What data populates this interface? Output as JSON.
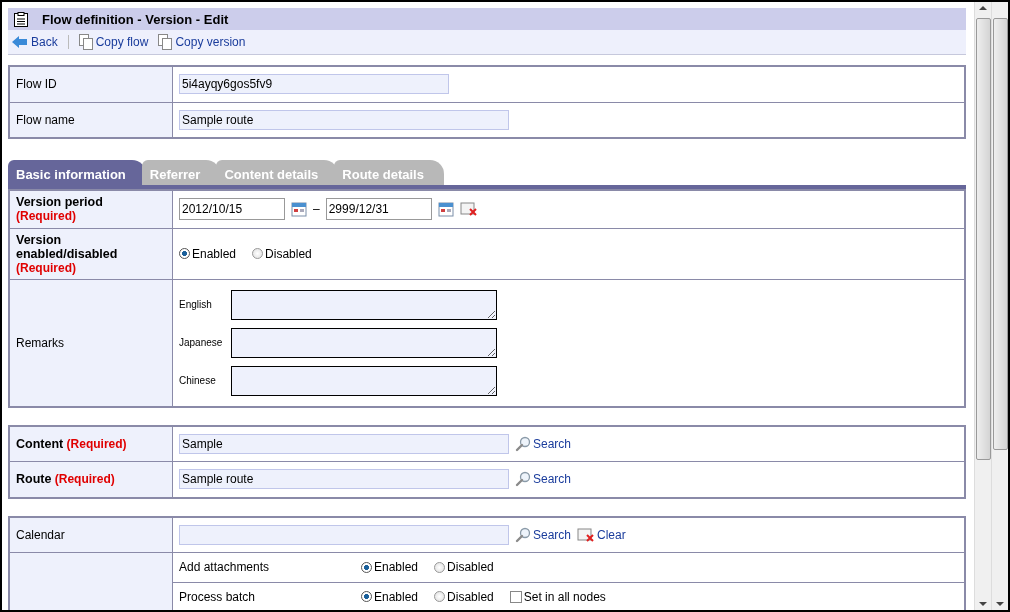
{
  "title": "Flow definition - Version - Edit",
  "toolbar": [
    {
      "label": "Back",
      "kind": "back"
    },
    {
      "label": "Copy flow",
      "kind": "copy"
    },
    {
      "label": "Copy version",
      "kind": "copy"
    }
  ],
  "header_fields": [
    {
      "label": "Flow ID",
      "value": "5i4ayqy6gos5fv9"
    },
    {
      "label": "Flow name",
      "value": "Sample route"
    }
  ],
  "tabs": [
    {
      "label": "Basic information",
      "selected": true
    },
    {
      "label": "Referrer",
      "selected": false
    },
    {
      "label": "Content details",
      "selected": false
    },
    {
      "label": "Route details",
      "selected": false
    }
  ],
  "version_period": {
    "label": "Version period",
    "required": "(Required)",
    "from": "2012/10/15",
    "separator": "–",
    "to": "2999/12/31"
  },
  "version_enabled": {
    "label": "Version enabled/disabled",
    "required": "(Required)",
    "options": [
      {
        "label": "Enabled",
        "selected": true
      },
      {
        "label": "Disabled",
        "selected": false
      }
    ]
  },
  "remarks": {
    "label": "Remarks",
    "languages": [
      {
        "label": "English"
      },
      {
        "label": "Japanese"
      },
      {
        "label": "Chinese"
      }
    ]
  },
  "lookups": [
    {
      "label": "Content",
      "required": "(Required)",
      "value": "Sample",
      "action": "Search"
    },
    {
      "label": "Route",
      "required": "(Required)",
      "value": "Sample route",
      "action": "Search"
    }
  ],
  "calendar": {
    "label": "Calendar",
    "search": "Search",
    "clear": "Clear"
  },
  "settings": [
    {
      "label": "Add attachments",
      "options": [
        {
          "label": "Enabled",
          "selected": true
        },
        {
          "label": "Disabled",
          "selected": false
        }
      ]
    },
    {
      "label": "Process batch",
      "options": [
        {
          "label": "Enabled",
          "selected": true
        },
        {
          "label": "Disabled",
          "selected": false
        }
      ],
      "set_all": {
        "label": "Set in all nodes",
        "checked": false
      }
    }
  ]
}
